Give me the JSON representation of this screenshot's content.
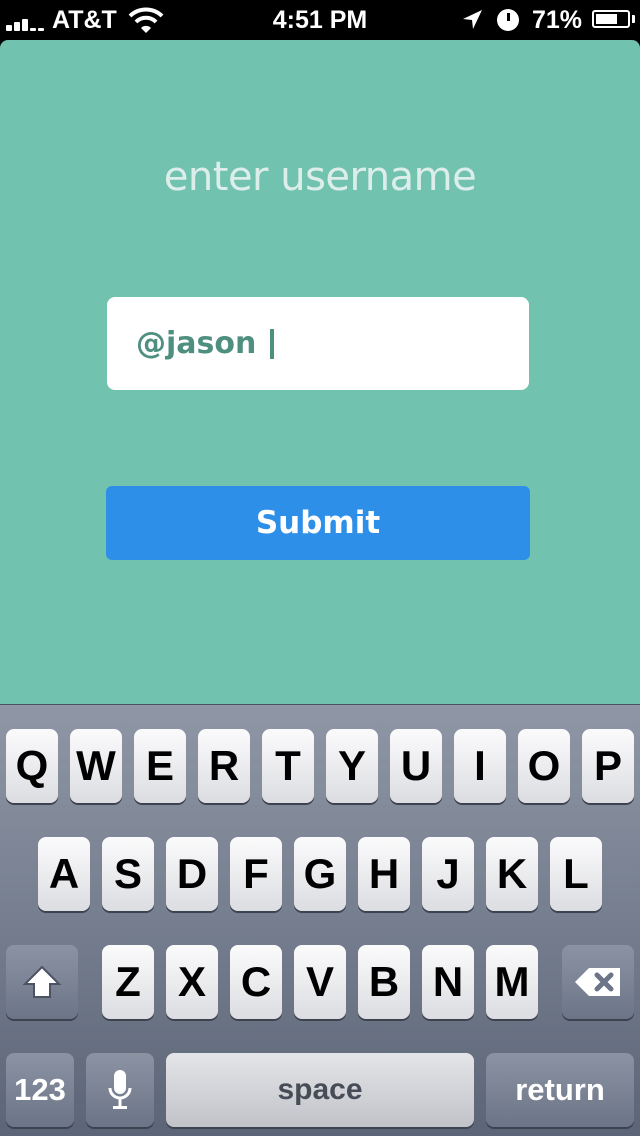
{
  "status_bar": {
    "carrier": "AT&T",
    "time": "4:51 PM",
    "battery_percent": "71%",
    "battery_level": 0.71,
    "icons": [
      "signal-icon",
      "wifi-icon",
      "location-arrow-icon",
      "alarm-clock-icon",
      "battery-icon"
    ]
  },
  "app": {
    "heading": "enter username",
    "username_value": "@jason",
    "submit_label": "Submit",
    "colors": {
      "background": "#72c2b0",
      "button": "#2e8fe8",
      "text_accent": "#4f8f80"
    }
  },
  "keyboard": {
    "row1": [
      "Q",
      "W",
      "E",
      "R",
      "T",
      "Y",
      "U",
      "I",
      "O",
      "P"
    ],
    "row2": [
      "A",
      "S",
      "D",
      "F",
      "G",
      "H",
      "J",
      "K",
      "L"
    ],
    "row3": [
      "Z",
      "X",
      "C",
      "V",
      "B",
      "N",
      "M"
    ],
    "numbers_label": "123",
    "space_label": "space",
    "return_label": "return",
    "icons": [
      "shift-icon",
      "backspace-icon",
      "microphone-icon"
    ]
  }
}
